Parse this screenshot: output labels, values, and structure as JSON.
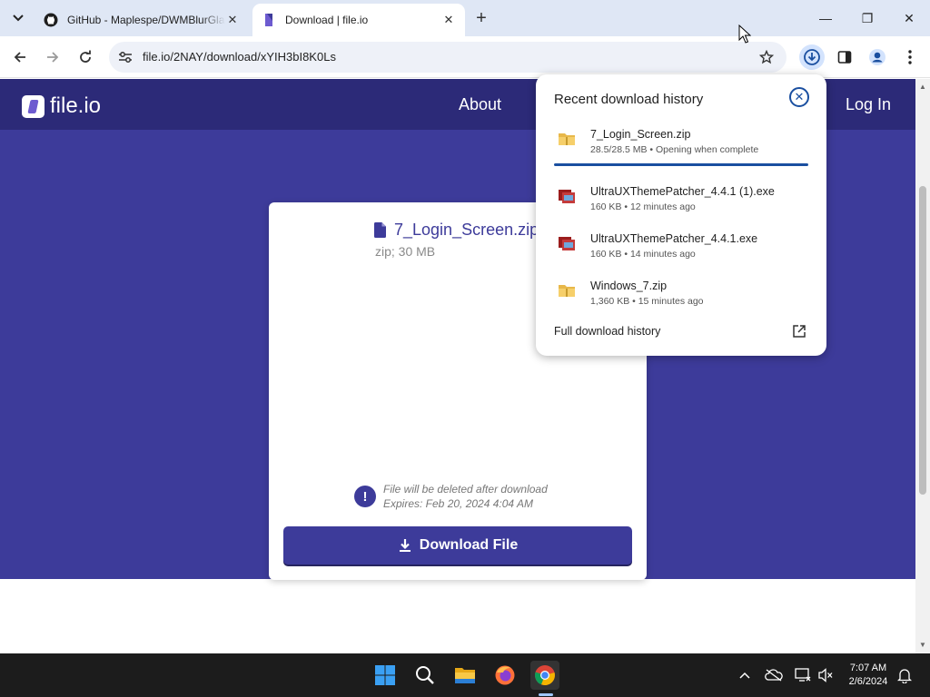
{
  "browser": {
    "tabs": [
      {
        "title": "GitHub - Maplespe/DWMBlurGlass",
        "active": false
      },
      {
        "title": "Download | file.io",
        "active": true
      }
    ],
    "new_tab_symbol": "+",
    "address": "file.io/2NAY/download/xYIH3bI8K0Ls",
    "window_controls": {
      "minimize": "—",
      "restore": "❐",
      "close": "✕"
    }
  },
  "site": {
    "logo_text": "file.io",
    "nav": {
      "about": "About",
      "login": "Log In"
    },
    "brand_color": "#3d3b9a"
  },
  "file_card": {
    "file_name": "7_Login_Screen.zip",
    "meta": "zip; 30 MB",
    "notice_line1": "File will be deleted after download",
    "notice_line2": "Expires: Feb 20, 2024 4:04 AM",
    "download_button": "Download File"
  },
  "download_bubble": {
    "title": "Recent download history",
    "items": [
      {
        "name": "7_Login_Screen.zip",
        "status": "28.5/28.5 MB • Opening when complete",
        "icon": "zip-folder-icon",
        "progress": 1.0
      },
      {
        "name": "UltraUXThemePatcher_4.4.1 (1).exe",
        "status": "160 KB • 12 minutes ago",
        "icon": "exe-installer-icon"
      },
      {
        "name": "UltraUXThemePatcher_4.4.1.exe",
        "status": "160 KB • 14 minutes ago",
        "icon": "exe-installer-icon"
      },
      {
        "name": "Windows_7.zip",
        "status": "1,360 KB • 15 minutes ago",
        "icon": "zip-folder-icon"
      }
    ],
    "full_history": "Full download history"
  },
  "taskbar": {
    "time": "7:07 AM",
    "date": "2/6/2024"
  }
}
